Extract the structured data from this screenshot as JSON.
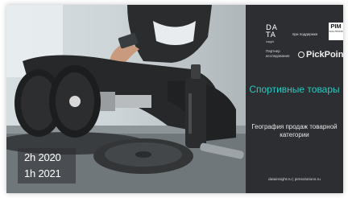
{
  "slide": {
    "period_line1": "2h 2020",
    "period_line2": "1h 2021"
  },
  "branding": {
    "datainsight_logo_line1": "DA",
    "datainsight_logo_line2": "TA",
    "datainsight_logo_sub": "insight",
    "support_text": "при поддержке",
    "pim_logo_text": "PIM",
    "pim_logo_sub": "SOLUTIONS",
    "partner_text": "Партнер исследования",
    "pickpoint_text": "PickPoint"
  },
  "content": {
    "title": "Спортивные товары",
    "subtitle": "География продаж товарной категории"
  },
  "footer": {
    "links": "datainsight.ru | pimsolutions.ru"
  },
  "colors": {
    "panel": "#2c2e31",
    "accent": "#2ec8c0"
  }
}
